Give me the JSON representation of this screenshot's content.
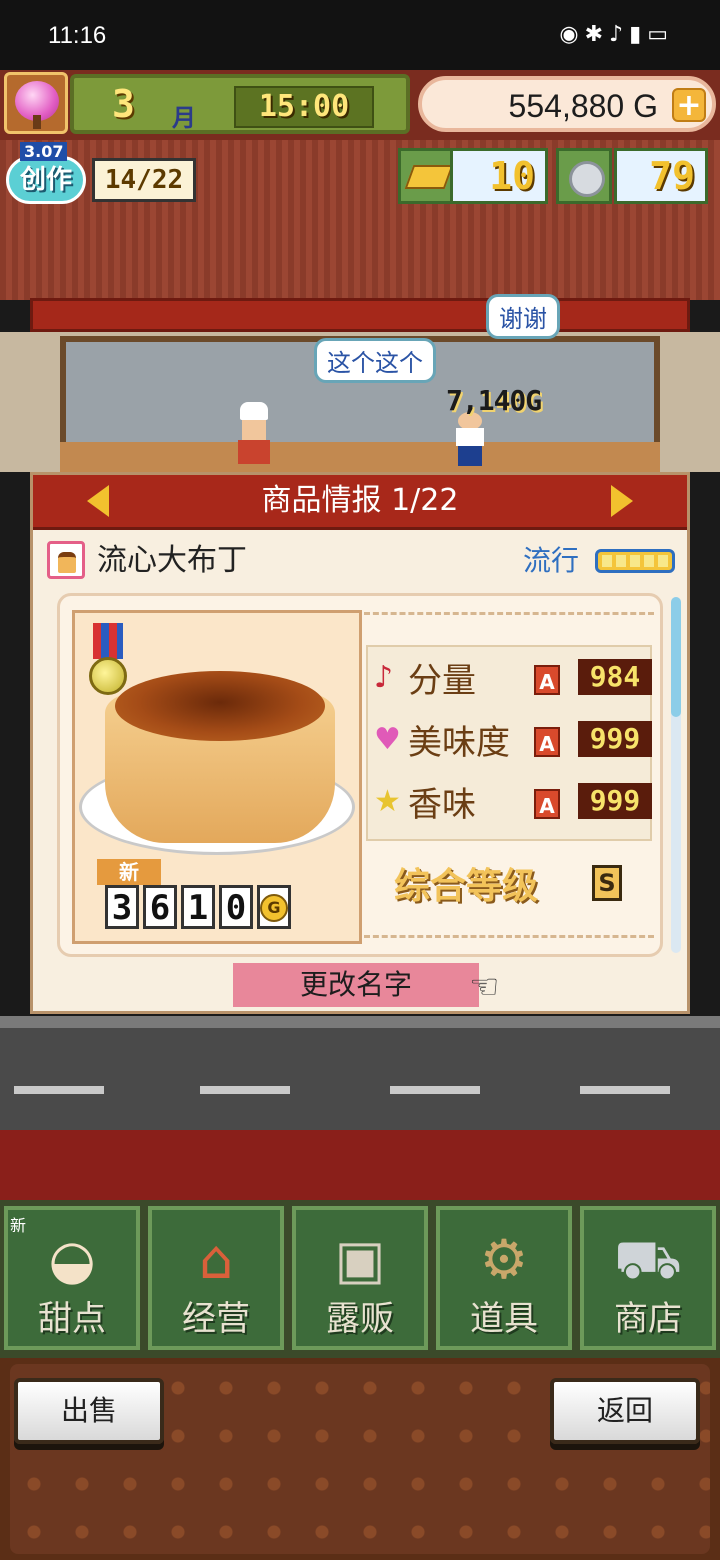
{
  "status_bar": {
    "time": "11:16",
    "icons": [
      "eye-icon",
      "bluetooth-icon",
      "silent-icon",
      "5g-signal-icon",
      "battery-icon"
    ]
  },
  "hud": {
    "month_num": "3",
    "month_label": "月",
    "clock": "15:00",
    "money": "554,880 G",
    "create_level": "3.07",
    "create_label": "创作",
    "create_progress": "14/22",
    "gold_count": "10",
    "silver_count": "79"
  },
  "scene": {
    "bubble_thanks": "谢谢",
    "bubble_this": "这个这个",
    "sale_amount": "7,140G"
  },
  "dialog": {
    "title": "商品情报 1/22",
    "item_name": "流心大布丁",
    "trend_label": "流行",
    "trend_level": 5,
    "new_tag": "新",
    "price_digits": [
      "3",
      "6",
      "1",
      "0"
    ],
    "price_unit": "G",
    "stats": [
      {
        "icon": "note-icon",
        "label": "分量",
        "rank": "A",
        "value": "984"
      },
      {
        "icon": "heart-icon",
        "label": "美味度",
        "rank": "A",
        "value": "999"
      },
      {
        "icon": "star-icon",
        "label": "香味",
        "rank": "A",
        "value": "999"
      }
    ],
    "overall_label": "综合等级",
    "overall_grade": "S",
    "rename_label": "更改名字"
  },
  "tabs": [
    {
      "label": "甜点",
      "icon": "cake-icon",
      "badge": "新"
    },
    {
      "label": "经营",
      "icon": "shop-icon"
    },
    {
      "label": "露贩",
      "icon": "food-truck-icon"
    },
    {
      "label": "道具",
      "icon": "gear-bag-icon"
    },
    {
      "label": "商店",
      "icon": "cart-icon"
    }
  ],
  "buttons": {
    "sell": "出售",
    "back": "返回"
  },
  "colors": {
    "dialog_title_bg": "#a8281a",
    "trend_blue": "#2f6fc0",
    "rank_red": "#d94a2c"
  }
}
